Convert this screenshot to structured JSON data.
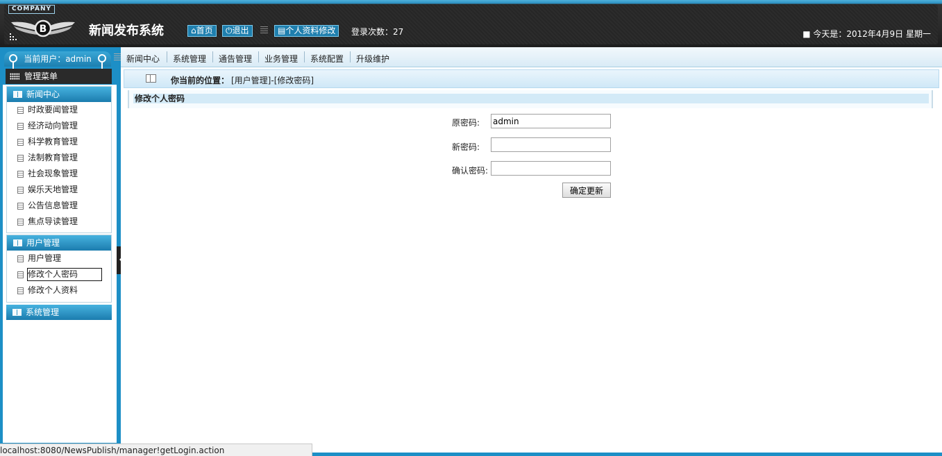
{
  "header": {
    "company": "COMPANY",
    "title": "新闻发布系统",
    "home_label": "首页",
    "logout_label": "退出",
    "profile_label": "个人资料修改",
    "login_count": "登录次数：27",
    "today": "■ 今天是：2012年4月9日 星期一"
  },
  "sidebar": {
    "current_user": "当前用户：admin",
    "menu_title": "管理菜单",
    "groups": [
      {
        "title": "新闻中心",
        "items": [
          "时政要闻管理",
          "经济动向管理",
          "科学教育管理",
          "法制教育管理",
          "社会现象管理",
          "娱乐天地管理",
          "公告信息管理",
          "焦点导读管理"
        ]
      },
      {
        "title": "用户管理",
        "items": [
          "用户管理",
          "修改个人密码",
          "修改个人资料"
        ]
      },
      {
        "title": "系统管理",
        "items": []
      }
    ]
  },
  "nav": [
    "新闻中心",
    "系统管理",
    "通告管理",
    "业务管理",
    "系统配置",
    "升级维护"
  ],
  "breadcrumb": {
    "label": "你当前的位置：",
    "path": "[用户管理]-[修改密码]"
  },
  "form": {
    "section_title": "修改个人密码",
    "old_label": "原密码:",
    "old_value": "admin",
    "new_label": "新密码:",
    "new_value": "",
    "confirm_label": "确认密码:",
    "confirm_value": "",
    "submit_label": "确定更新"
  },
  "status_bar": "localhost:8080/NewsPublish/manager!getLogin.action",
  "colors": {
    "accent": "#1d8fc6",
    "header_dark": "#2a2a2a"
  }
}
